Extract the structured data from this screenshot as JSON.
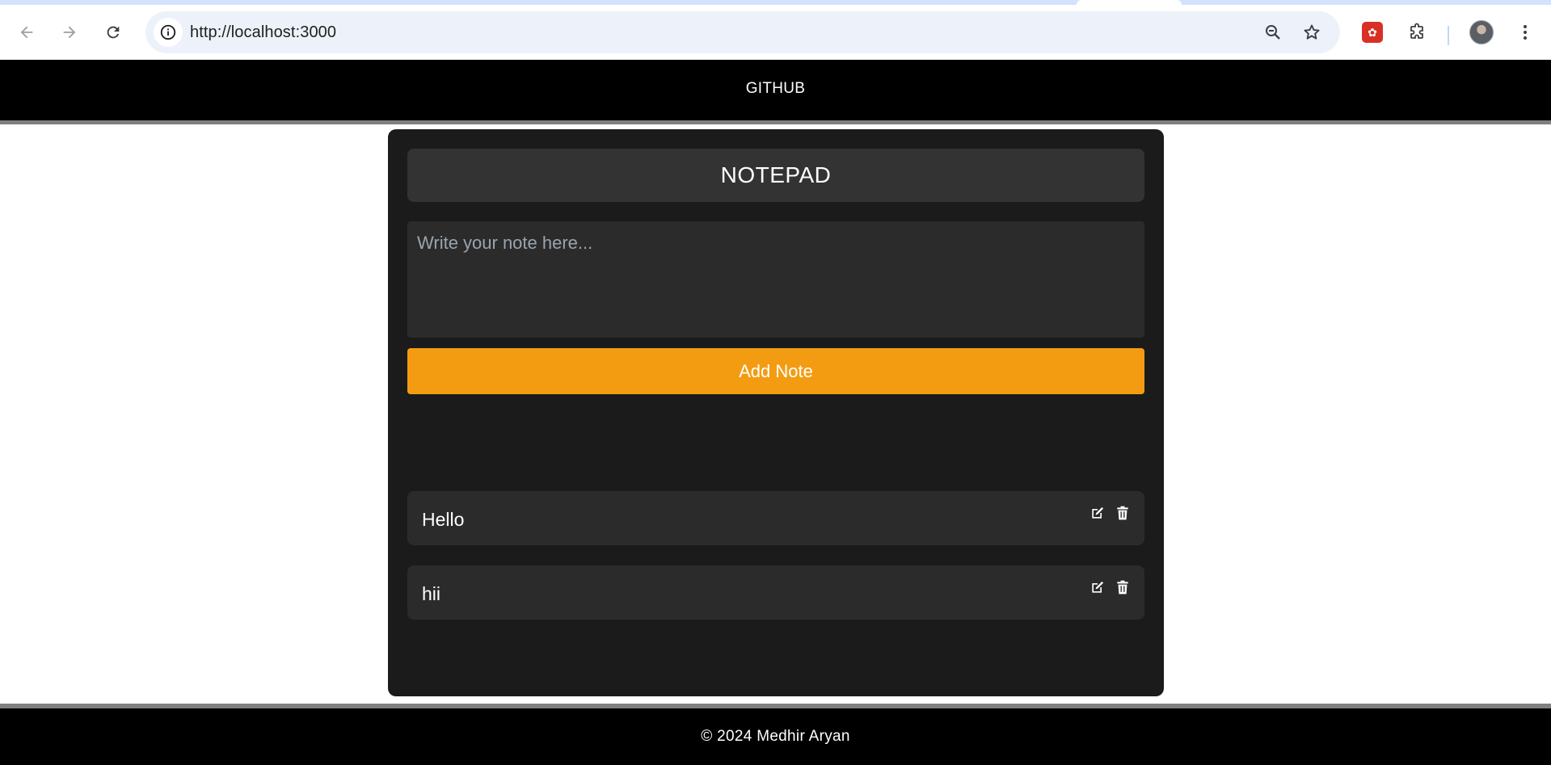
{
  "browser": {
    "url": "http://localhost:3000",
    "icons": {
      "back": "back-arrow-icon",
      "forward": "forward-arrow-icon",
      "reload": "reload-icon",
      "site_info": "info-icon",
      "zoom": "zoom-out-icon",
      "bookmark": "star-icon",
      "extension": "extension-icon",
      "puzzle": "puzzle-icon",
      "profile": "avatar",
      "menu": "kebab-menu-icon"
    }
  },
  "header": {
    "link_label": "GITHUB"
  },
  "notepad": {
    "title": "NOTEPAD",
    "input_placeholder": "Write your note here...",
    "input_value": "",
    "add_button_label": "Add Note",
    "notes": [
      {
        "text": "Hello"
      },
      {
        "text": "hii"
      }
    ]
  },
  "footer": {
    "copyright": "© 2024 Medhir Aryan"
  },
  "colors": {
    "header_bg": "#000000",
    "card_bg": "#1b1b1b",
    "accent": "#f39c12",
    "note_bg": "#2b2b2b",
    "divider": "#808080"
  }
}
